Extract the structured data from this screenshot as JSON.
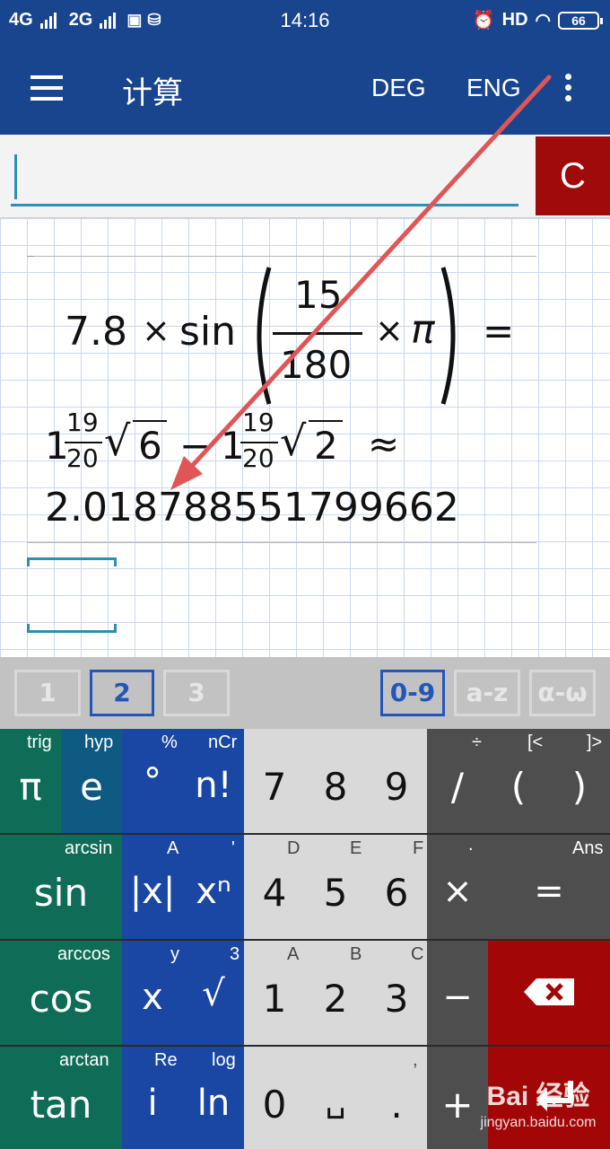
{
  "status_bar": {
    "net1": "4G",
    "net2": "2G",
    "time": "14:16",
    "hd": "HD",
    "battery": "66"
  },
  "app_bar": {
    "title": "计算",
    "deg_label": "DEG",
    "eng_label": "ENG"
  },
  "input": {
    "value": "",
    "clear_label": "C"
  },
  "result": {
    "coef": "7.8",
    "times": "×",
    "func": "sin",
    "frac_num": "15",
    "frac_den": "180",
    "pi": "π",
    "equals": "=",
    "mixed1_whole": "1",
    "mixed1_num": "19",
    "mixed1_den": "20",
    "sqrt_symbol": "√",
    "rad1": "6",
    "minus": "−",
    "mixed2_whole": "1",
    "mixed2_num": "19",
    "mixed2_den": "20",
    "rad2": "2",
    "approx": "≈",
    "decimal": "2.018788551799662"
  },
  "tabs": {
    "t1": "1",
    "t2": "2",
    "t3": "3",
    "t4": "0-9",
    "t5": "a-z",
    "t6": "α-ω"
  },
  "keys": {
    "pi": {
      "main": "π",
      "sub": "trig"
    },
    "e": {
      "main": "e",
      "sub": "hyp"
    },
    "degree": {
      "main": "°",
      "sub": "%"
    },
    "fact": {
      "main": "n!",
      "sub": "nCr"
    },
    "k7": {
      "main": "7"
    },
    "k8": {
      "main": "8"
    },
    "k9": {
      "main": "9"
    },
    "div": {
      "main": "/",
      "sub": "÷"
    },
    "lparen": {
      "main": "(",
      "sub": "[<"
    },
    "rparen": {
      "main": ")",
      "sub": "]>"
    },
    "sin": {
      "main": "sin",
      "sub": "arcsin"
    },
    "abs": {
      "main": "|x|",
      "sub": "A"
    },
    "pow": {
      "main": "xⁿ",
      "sub": "'"
    },
    "k4": {
      "main": "4",
      "sub": "D"
    },
    "k5": {
      "main": "5",
      "sub": "E"
    },
    "k6": {
      "main": "6",
      "sub": "F"
    },
    "mul": {
      "main": "×",
      "sub": "."
    },
    "eq": {
      "main": "=",
      "sub": "Ans"
    },
    "cos": {
      "main": "cos",
      "sub": "arccos"
    },
    "x": {
      "main": "x",
      "sub": "y"
    },
    "sqrt": {
      "main": "√",
      "sub": "3"
    },
    "k1": {
      "main": "1",
      "sub": "A"
    },
    "k2": {
      "main": "2",
      "sub": "B"
    },
    "k3": {
      "main": "3",
      "sub": "C"
    },
    "minus": {
      "main": "−"
    },
    "tan": {
      "main": "tan",
      "sub": "arctan"
    },
    "i": {
      "main": "i",
      "sub": "Re"
    },
    "ln": {
      "main": "ln",
      "sub": "log"
    },
    "k0": {
      "main": "0"
    },
    "space": {
      "main": "␣"
    },
    "dot": {
      "main": ".",
      "sub": ","
    },
    "plus": {
      "main": "+"
    }
  },
  "watermark": {
    "brand": "Bai 经验",
    "url": "jingyan.baidu.com"
  },
  "colors": {
    "primary": "#19458f",
    "clear_red": "#a00a0a",
    "accent_teal": "#2f8fb3"
  }
}
